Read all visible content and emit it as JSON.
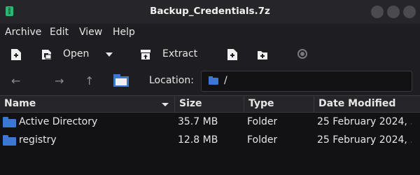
{
  "window": {
    "title": "Backup_Credentials.7z"
  },
  "menu": {
    "items": [
      "Archive",
      "Edit",
      "View",
      "Help"
    ]
  },
  "toolbar": {
    "open_label": "Open",
    "extract_label": "Extract"
  },
  "location": {
    "label": "Location:",
    "value": "/"
  },
  "table": {
    "columns": [
      "Name",
      "Size",
      "Type",
      "Date Modified"
    ],
    "rows": [
      {
        "name": "Active Directory",
        "size": "35.7 MB",
        "type": "Folder",
        "date": "25 February 2024, ..."
      },
      {
        "name": "registry",
        "size": "12.8 MB",
        "type": "Folder",
        "date": "25 February 2024, ..."
      }
    ]
  },
  "colors": {
    "folder": "#3a78d4",
    "background": "#1e1e22",
    "list_background": "#121214",
    "app_icon": "#2bb673"
  },
  "icons": {
    "app": "archive-app-icon",
    "add_file": "add-file-icon",
    "open": "open-archive-icon",
    "extract": "extract-icon",
    "new_file": "new-file-icon",
    "new_folder": "new-folder-icon",
    "record": "record-icon"
  }
}
